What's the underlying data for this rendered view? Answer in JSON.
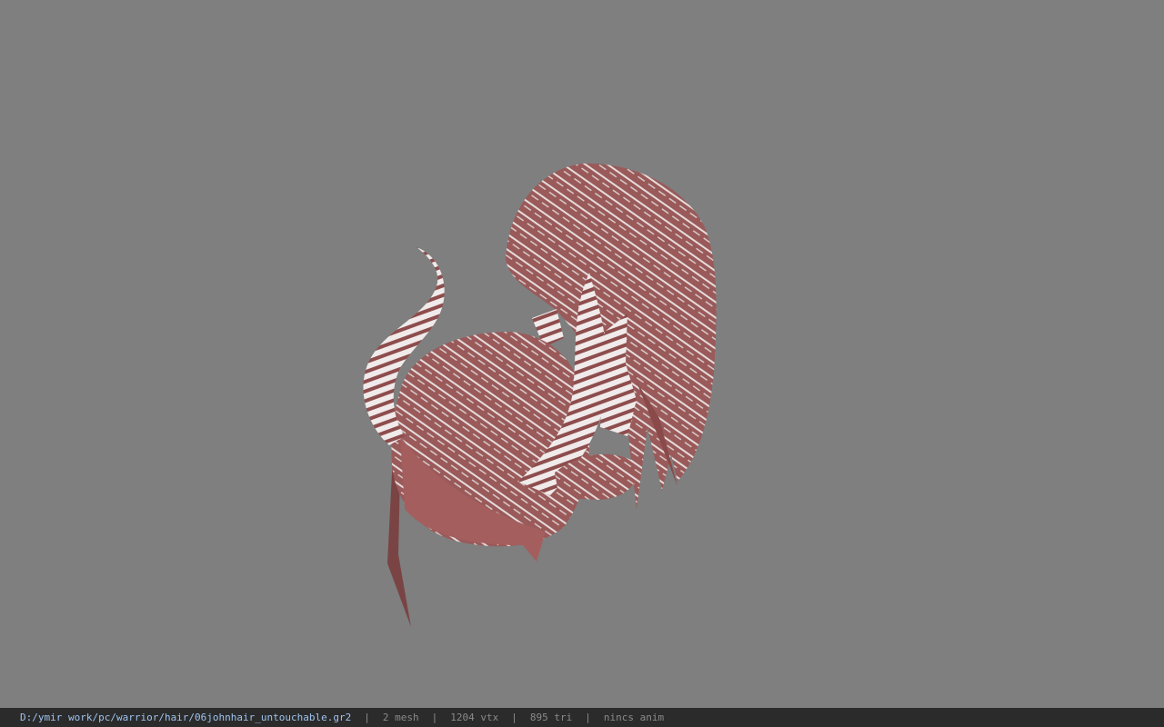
{
  "viewer": {
    "background_color": "#7f7f7f",
    "model_description": "hair",
    "hair_color": "#9a5a5a",
    "highlight_color": "#e8e0e0"
  },
  "status_bar": {
    "file_path": "D:/ymir work/pc/warrior/hair/06johnhair_untouchable.gr2",
    "mesh_count": "2 mesh",
    "vertex_count": "1204 vtx",
    "triangle_count": "895 tri",
    "animation": "nincs anim",
    "separator": "|"
  }
}
